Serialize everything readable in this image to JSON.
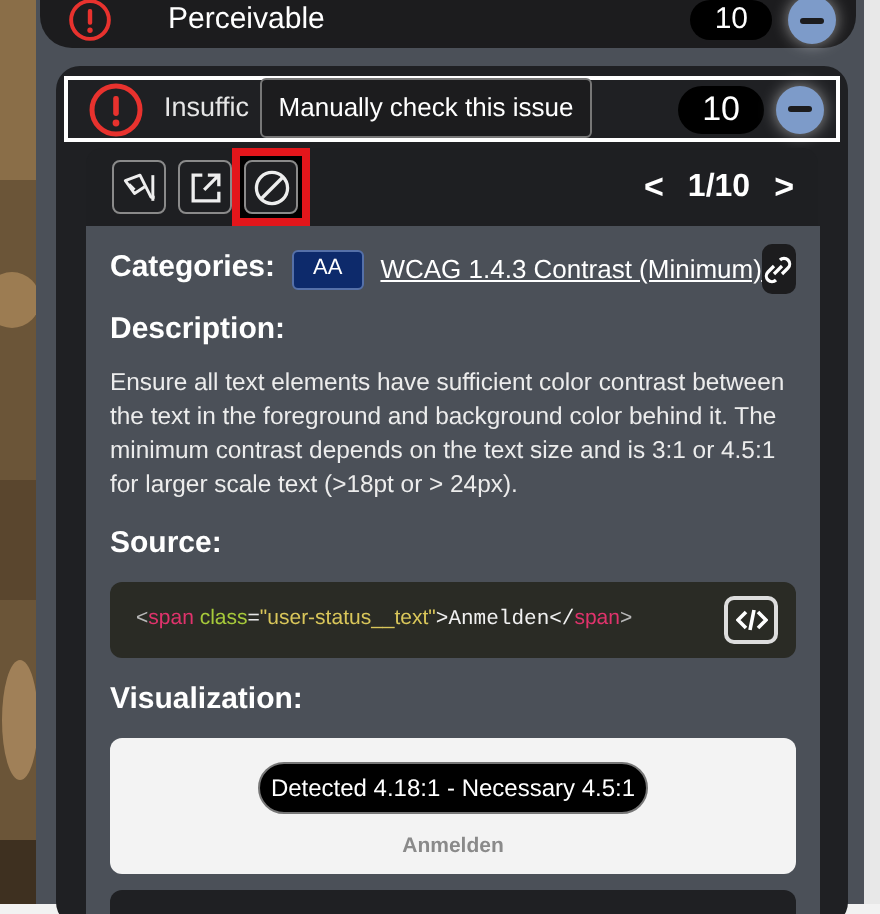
{
  "category": {
    "title": "Perceivable",
    "count": "10",
    "expanded": true
  },
  "issue": {
    "title": "Insuffic",
    "count": "10",
    "expanded": true,
    "focused": true
  },
  "tooltip": "Manually check this issue",
  "toolbar": {
    "buttons": [
      {
        "kind": "highlight",
        "highlighted": false
      },
      {
        "kind": "open",
        "highlighted": false
      },
      {
        "kind": "ignore",
        "highlighted": true
      }
    ],
    "prev": "<",
    "pager": "1/10",
    "next": ">"
  },
  "categories_label": "Categories:",
  "level_badge": "AA",
  "criterion_link": "WCAG 1.4.3 Contrast (Minimum)",
  "description_label": "Description:",
  "description": "Ensure all text elements have sufficient color contrast between the text in the foreground and background color behind it. The minimum contrast depends on the text size and is 3:1 or 4.5:1 for larger scale text (>18pt or > 24px).",
  "source_label": "Source:",
  "source": [
    {
      "kind": "punct",
      "text": "<"
    },
    {
      "kind": "tag",
      "text": "span"
    },
    {
      "kind": "attr",
      "text": " class"
    },
    {
      "kind": "plain",
      "text": "="
    },
    {
      "kind": "string",
      "text": "\"user-status__text\""
    },
    {
      "kind": "code",
      "text": ">Anmelden</"
    },
    {
      "kind": "tag",
      "text": "span"
    },
    {
      "kind": "punct",
      "text": ">"
    }
  ],
  "visualization_label": "Visualization:",
  "visualization": {
    "result": "Detected 4.18:1 - Necessary 4.5:1",
    "sample": "Anmelden"
  }
}
